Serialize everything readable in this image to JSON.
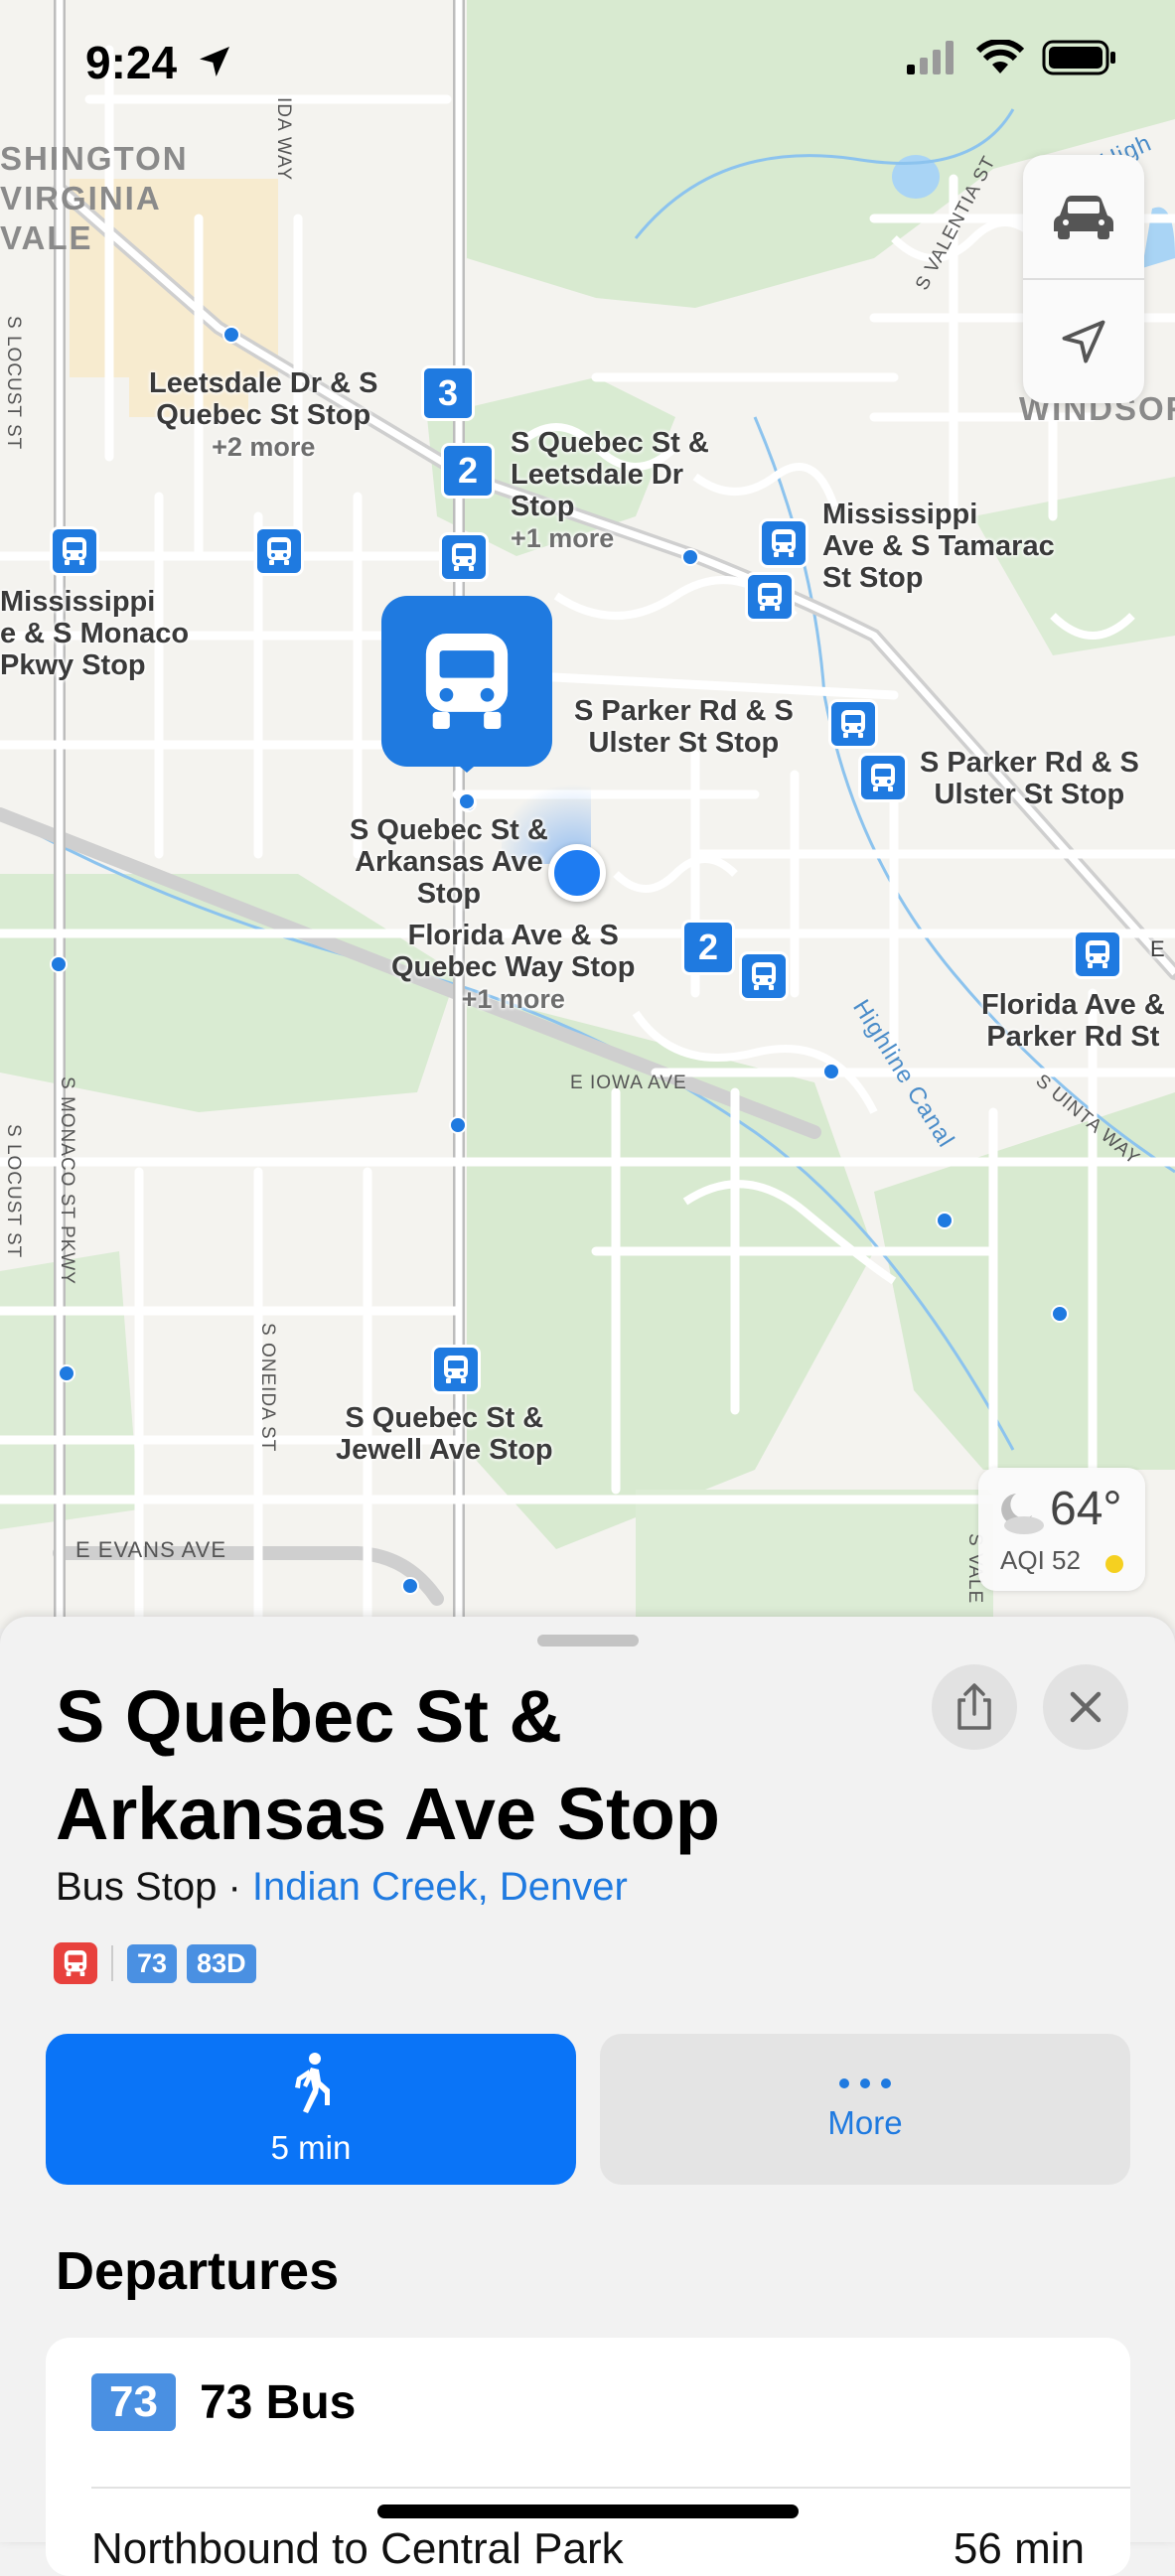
{
  "status_bar": {
    "time": "9:24"
  },
  "map": {
    "districts": {
      "washington": "SHINGTON\nVIRGINIA\nVALE",
      "windsor": "WINDSOR"
    },
    "streets": {
      "ida_way": "IDA WAY",
      "valentia": "S VALENTIA ST",
      "locust_top": "S LOCUST ST",
      "locust_bottom": "S LOCUST ST",
      "monaco_pkwy": "S MONACO ST PKWY",
      "oneida": "S ONEIDA ST",
      "iowa": "E IOWA AVE",
      "evans": "E EVANS AVE",
      "uinta": "S UINTA WAY",
      "vale": "S VALE",
      "highline": "Highline Canal",
      "highline_top": "High"
    },
    "labels": {
      "leetsdale_quebec": "Leetsdale Dr & S\nQuebec St Stop",
      "leetsdale_quebec_more": "+2 more",
      "quebec_leetsdale": "S Quebec St &\nLeetsdale Dr\nStop",
      "quebec_leetsdale_more": "+1 more",
      "mississippi_tamarac": "Mississippi\nAve & S Tamarac\nSt Stop",
      "mississippi_monaco": "Mississippi\ne & S Monaco\nPkwy Stop",
      "parker_ulster_1": "S Parker Rd & S\nUlster St Stop",
      "parker_ulster_2": "S Parker Rd & S\nUlster St Stop",
      "quebec_arkansas": "S Quebec St &\nArkansas Ave\nStop",
      "florida_quebec": "Florida Ave & S\nQuebec Way Stop",
      "florida_quebec_more": "+1 more",
      "florida_parker": "Florida Ave &\nParker Rd St",
      "quebec_jewell": "S Quebec St &\nJewell Ave Stop",
      "florida_e": "E"
    },
    "clusters": {
      "c1": "3",
      "c2": "2",
      "c3": "2"
    },
    "weather": {
      "temp": "64°",
      "aqi": "AQI 52"
    }
  },
  "sheet": {
    "title": "S Quebec St & Arkansas Ave Stop",
    "type": "Bus Stop",
    "separator": " · ",
    "location_link": "Indian Creek, Denver",
    "routes": [
      "73",
      "83D"
    ],
    "walk_label": "5 min",
    "more_label": "More",
    "departures_title": "Departures",
    "departure": {
      "route": "73",
      "name": "73 Bus",
      "direction": "Northbound to Central Park",
      "eta": "56 min"
    }
  },
  "colors": {
    "accent": "#1f7ae0",
    "primary_button": "#0a74f7",
    "bus_red": "#e8413d",
    "route_chip": "#4a90e2"
  }
}
